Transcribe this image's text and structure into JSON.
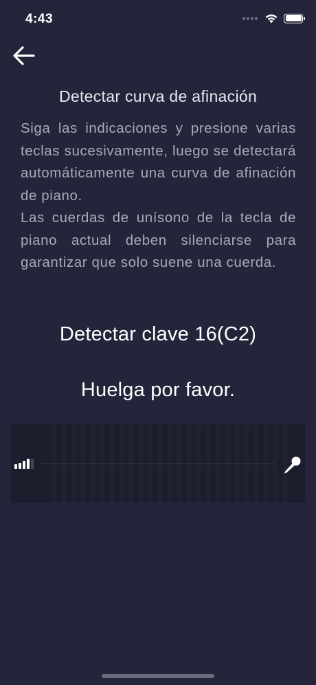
{
  "status_bar": {
    "time": "4:43"
  },
  "nav": {
    "back_icon": "arrow-left-icon"
  },
  "content": {
    "title": "Detectar curva de afinación",
    "instructions": [
      "Siga las indicaciones y presione varias teclas sucesivamente, luego se detectará automáticamente una curva de afinación de piano.",
      "Las cuerdas de unísono de la tecla de piano actual deben silenciarse para garantizar que solo suene una cuerda."
    ],
    "detect_key": "Detectar clave 16(C2)",
    "prompt": "Huelga por favor."
  },
  "audio_panel": {
    "level_icon": "signal-level-icon",
    "mic_icon": "microphone-icon"
  },
  "colors": {
    "background": "#24253a",
    "panel": "#1d1e2d",
    "text_primary": "#ffffff",
    "text_secondary": "#a9aab6"
  }
}
